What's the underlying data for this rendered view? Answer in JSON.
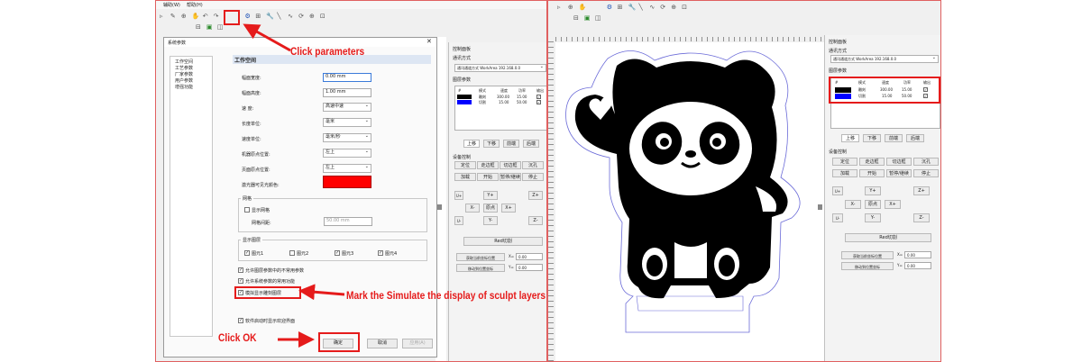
{
  "left": {
    "menu": [
      "辅助(W)",
      "帮助(H)"
    ],
    "dialog": {
      "title": "系统参数",
      "tree": [
        "工作空间",
        "工艺参数",
        "厂家参数",
        "用户参数",
        "增强功能"
      ],
      "section_title": "工作空间",
      "fields": [
        {
          "label": "幅面宽度:",
          "value": "0.00 mm",
          "kind": "input"
        },
        {
          "label": "幅面高度:",
          "value": "1.00 mm",
          "kind": "input"
        },
        {
          "label": "速  度:",
          "value": "高速中速",
          "kind": "select"
        },
        {
          "label": "长度单位:",
          "value": "毫米",
          "kind": "select"
        },
        {
          "label": "速度单位:",
          "value": "毫米/秒",
          "kind": "select"
        },
        {
          "label": "机器原点位置:",
          "value": "左上",
          "kind": "select"
        },
        {
          "label": "页面原点位置:",
          "value": "左上",
          "kind": "select"
        },
        {
          "label": "激光器可见光颜色:",
          "value": "",
          "kind": "color",
          "color": "#ff0000"
        }
      ],
      "grid": {
        "title": "网格",
        "show_label": "显示网格",
        "spacing_label": "网格间距:",
        "spacing_value": "50.00 mm"
      },
      "layers": {
        "title": "显示图层",
        "items": [
          {
            "label": "图元1",
            "checked": true
          },
          {
            "label": "图元2",
            "checked": false
          },
          {
            "label": "图元3",
            "checked": true
          },
          {
            "label": "图元4",
            "checked": true
          }
        ]
      },
      "options": [
        {
          "label": "允许图层参数中的不常用参数",
          "checked": true
        },
        {
          "label": "允许系统参数的常用功能",
          "checked": true
        },
        {
          "label": "模拟显示雕刻图层",
          "checked": true
        },
        {
          "label": "软件启动时显示欢迎界面",
          "checked": true
        }
      ],
      "buttons": {
        "ok": "确定",
        "cancel": "取消",
        "apply": "应用(A)"
      }
    },
    "panel": {
      "tab": "控制面板",
      "conn_title": "通讯方式",
      "conn_value": "通讯通道方式  WorkArea 192.168.0.0",
      "layer_title": "图层参数",
      "layer_headers": [
        "#",
        "模式",
        "速度",
        "功率",
        "输出"
      ],
      "layer_rows": [
        {
          "color": "#000000",
          "mode": "雕刻",
          "speed": "300.00",
          "power": "15.00",
          "output": true
        },
        {
          "color": "#0000ff",
          "mode": "切割",
          "speed": "15.00",
          "power": "50.00",
          "output": true
        }
      ],
      "layer_buttons": [
        "上移",
        "下移",
        "前端",
        "后端"
      ],
      "device_title": "设备控制",
      "device_buttons": [
        "定位",
        "走边框",
        "切边框",
        "沉孔",
        "加载",
        "开始",
        "暂停/继续",
        "停止"
      ],
      "jog": {
        "up": "Y+",
        "left": "X-",
        "origin": "原点",
        "right": "X+",
        "down": "Y-",
        "z_up": "Z+",
        "z_down": "Z-",
        "u_up": "U+",
        "u_down": "U-"
      },
      "bottom_button": "Red切割",
      "pos_buttons": [
        "获取当前坐标位置",
        "移动到位置坐标"
      ],
      "x_label": "X=",
      "x_value": "0.00",
      "y_label": "Y=",
      "y_value": "0.00"
    }
  },
  "right": {
    "panel": {
      "tab": "控制面板",
      "conn_title": "通讯方式",
      "conn_value": "通讯通道方式  WorkArea 192.168.0.0",
      "layer_title": "图层参数",
      "layer_headers": [
        "#",
        "模式",
        "速度",
        "功率",
        "输出"
      ],
      "layer_rows": [
        {
          "color": "#000000",
          "mode": "雕刻",
          "speed": "300.00",
          "power": "15.00",
          "output": true
        },
        {
          "color": "#0000ff",
          "mode": "切割",
          "speed": "15.00",
          "power": "50.00",
          "output": true
        }
      ],
      "layer_buttons": [
        "上移",
        "下移",
        "前端",
        "后端"
      ],
      "device_title": "设备控制",
      "device_buttons": [
        "定位",
        "走边框",
        "切边框",
        "沉孔",
        "加载",
        "开始",
        "暂停/继续",
        "停止"
      ],
      "jog": {
        "up": "Y+",
        "left": "X-",
        "origin": "原点",
        "right": "X+",
        "down": "Y-",
        "z_up": "Z+",
        "z_down": "Z-",
        "u_up": "U+",
        "u_down": "U-"
      },
      "bottom_button": "Red切割",
      "pos_buttons": [
        "获取当前坐标位置",
        "移动到位置坐标"
      ],
      "x_label": "X=",
      "x_value": "0.00",
      "y_label": "Y=",
      "y_value": "0.00"
    }
  },
  "callouts": {
    "click_parameters": "Click parameters",
    "mark_simulate": "Mark the Simulate the display of sculpt layers",
    "click_ok": "Click OK"
  },
  "colors": {
    "accent": "#e51b1b",
    "window_border": "#e06060",
    "layer_blue": "#0000ff",
    "cut_outline": "#6b6bd8"
  }
}
